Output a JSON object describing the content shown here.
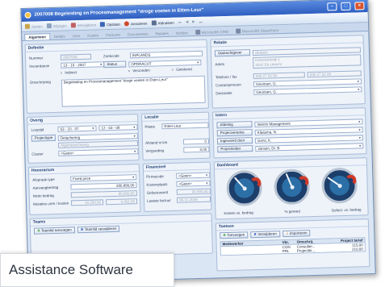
{
  "window": {
    "title": "2007008 Begeleiding en Procesmanagement \"droge voeten in Etten-Leur\""
  },
  "toolbar": {
    "items": [
      {
        "label": "Sluiten",
        "active": false,
        "color": "#c9a64a"
      },
      {
        "label": "Wijzigen",
        "active": false,
        "color": "#8fa3c0"
      },
      {
        "label": "Verwijderen",
        "active": false,
        "color": "#c06060"
      },
      {
        "label": "Opslaan",
        "active": true,
        "color": "#3a66b8"
      },
      {
        "label": "Annuleren",
        "active": true,
        "color": "#d04a2a"
      },
      {
        "label": "Afdrukken",
        "active": true,
        "color": "#5a6e90"
      }
    ]
  },
  "tabs": [
    {
      "label": "Algemeen",
      "active": true
    },
    {
      "label": "Details",
      "active": false
    },
    {
      "label": "Uren",
      "active": false
    },
    {
      "label": "Kosten",
      "active": false
    },
    {
      "label": "Facturen",
      "active": false
    },
    {
      "label": "Documenten",
      "active": false
    },
    {
      "label": "Relaties",
      "active": false
    },
    {
      "label": "Notities",
      "active": false
    },
    {
      "label": "Microsoft® CRM",
      "active": false
    },
    {
      "label": "Microsoft® SharePoint",
      "active": false
    }
  ],
  "definitie": {
    "heading": "Definitie",
    "nummer_label": "Nummer",
    "nummer": "2007008",
    "zoekcode_label": "Zoekcode",
    "zoekcode": "INPLANDS",
    "invoerdatum_label": "Invoerdatum",
    "invoerdatum": "13 - 10 - 2007",
    "status_label": "Status",
    "status": "OPDRACHT",
    "indirect_label": "Indirect",
    "verzonden_label": "Verzonden",
    "getekend_label": "Getekend",
    "omschrijving_label": "Omschrijving",
    "omschrijving": "Begeleiding en Procesmanagement \"droge voeten in Etten-Leur\""
  },
  "relatie": {
    "heading": "Relatie",
    "opdrachtgever_label": "Opdrachtgever",
    "opdrachtgever": "Stratem",
    "adres_label": "Adres",
    "adres_1": "Keesreenwijk 1",
    "adres_2": "3042 EA Utrecht",
    "telefoon_label": "Telefoon / fax",
    "telefoon": "030 27 52 00",
    "fax": "030 27 52 09",
    "contactpersoon_label": "Contactpersoon",
    "contactpersoon": "Geurtsen, G.",
    "declaratie_label": "Declaratie",
    "declaratie": "Geurtsen, G."
  },
  "overig": {
    "heading": "Overig",
    "looptijd_label": "Looptijd",
    "looptijd_van": "03 - 10 - 07",
    "looptijd_tot": "12 - 03 - 08",
    "projecttype_label": "Projecttype",
    "projecttype": "Detachering",
    "subtype": "Algemeen/Overig",
    "cluster_label": "Cluster",
    "cluster": "<Geen>"
  },
  "locatie": {
    "heading": "Locatie",
    "plaats_label": "Plaats",
    "plaats": "Etten-Leur",
    "afstand_label": "Afstand in km.",
    "afstand": "0",
    "vergoeding_label": "Vergoeding",
    "vergoeding": "0,00"
  },
  "intern": {
    "heading": "Intern",
    "rows": [
      {
        "label": "Afdeling",
        "value": "Interim Management"
      },
      {
        "label": "Projectverantw.",
        "value": "Klaasma, N."
      },
      {
        "label": "Ingevoerd door",
        "value": "Gons, K."
      },
      {
        "label": "Projectleider",
        "value": "Jansen, Dr. B."
      }
    ]
  },
  "honorarium": {
    "heading": "Honorarium",
    "afspraak_label": "Afspraak type",
    "afspraak": "Fixed price",
    "aanvang_label": "Aanvangbedrag",
    "aanvang": "280.890,00",
    "netto_label": "Netto bedrag",
    "netto": "80.000,00",
    "mutaties_label": "Mutaties uren / kosten",
    "mutaties_1": "10.200,00",
    "mutaties_2": "9.451,00"
  },
  "financieel": {
    "heading": "Financieel",
    "pirmacode_label": "Pirmacode",
    "pirmacode": "<Geen>",
    "kostenplaats_label": "Kostenplaats",
    "kostenplaats": "<Geen>",
    "gefactureerd_label": "Gefactureerd",
    "gefactureerd": "32.000,00",
    "laatste_label": "Laatste factuur",
    "laatste": "06-11-2008"
  },
  "dashboard": {
    "heading": "Dashboard",
    "gauges": [
      {
        "label": "Kosten vs. bedrag",
        "value": 0.35
      },
      {
        "label": "% gereed",
        "value": 0.42
      },
      {
        "label": "Gefact. vs. bedrag",
        "value": 0.3
      }
    ]
  },
  "teams": {
    "heading": "Teams",
    "add_label": "Teamlid toevoegen",
    "remove_label": "Teamlid verwijderen"
  },
  "taken": {
    "heading": "Toetsen",
    "add_label": "Toevoegen",
    "remove_label": "Verwijderen",
    "import_label": "Importeren",
    "columns": [
      "Medewerker",
      "Vbr.",
      "Omschrij.",
      "Project tarief"
    ],
    "rows": [
      {
        "medewerker": "",
        "vbr": "CON",
        "omschrijving": "Consulter...",
        "tarief": "115,00"
      },
      {
        "medewerker": "",
        "vbr": "PRL",
        "omschrijving": "Projectlei...",
        "tarief": "210,00"
      }
    ]
  },
  "watermark": {
    "text": "Assistance Software"
  }
}
